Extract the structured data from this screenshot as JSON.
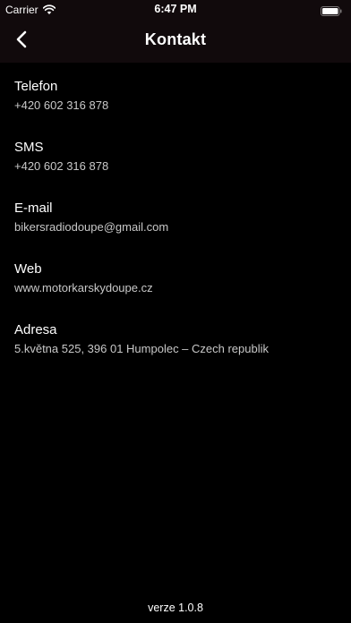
{
  "status_bar": {
    "carrier": "Carrier",
    "time": "6:47 PM",
    "wifi_icon": "wifi-icon",
    "battery_icon": "battery-icon"
  },
  "nav": {
    "title": "Kontakt",
    "back_icon": "chevron-left-icon"
  },
  "contacts": [
    {
      "label": "Telefon",
      "value": "+420 602 316 878"
    },
    {
      "label": "SMS",
      "value": "+420 602 316 878"
    },
    {
      "label": "E-mail",
      "value": "bikersradiodoupe@gmail.com"
    },
    {
      "label": "Web",
      "value": "www.motorkarskydoupe.cz"
    },
    {
      "label": "Adresa",
      "value": "5.května 525, 396 01 Humpolec – Czech republik"
    }
  ],
  "footer": {
    "version": "verze 1.0.8"
  },
  "colors": {
    "background": "#000000",
    "bar_background": "#110a0c",
    "text_primary": "#ffffff",
    "text_secondary": "#c8c8c8"
  }
}
